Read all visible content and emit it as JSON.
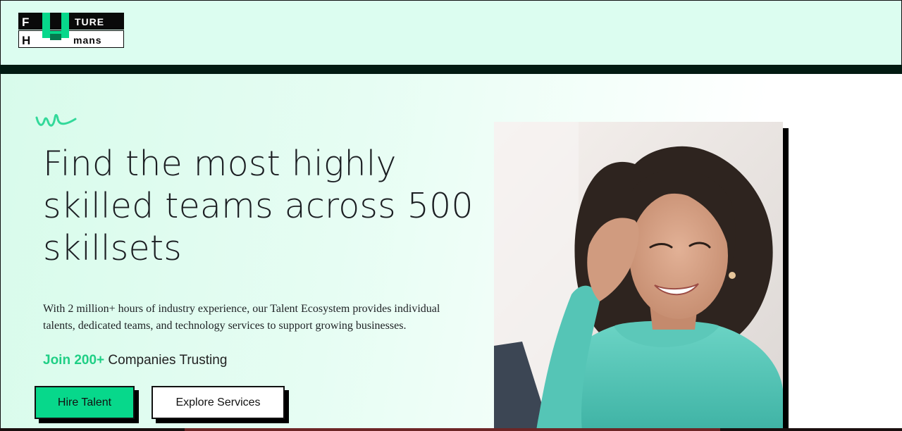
{
  "brand": {
    "logo_top_left": "F",
    "logo_top_right": "TURE",
    "logo_bottom_left": "H",
    "logo_bottom_right": "mans",
    "logo_center": "U"
  },
  "hero": {
    "headline": "Find the most highly skilled teams across 500 skillsets",
    "description": "With 2 million+ hours of industry experience, our Talent Ecosystem provides individual talents, dedicated teams, and technology services to support growing businesses.",
    "trust_accent": "Join 200+",
    "trust_rest": " Companies Trusting",
    "hire_label": "Hire Talent",
    "explore_label": "Explore Services"
  },
  "colors": {
    "header_bg": "#dcfdf0",
    "accent": "#07d88b",
    "accent_text": "#1fcf85",
    "dark": "#021a12"
  },
  "icons": {
    "squiggle": "squiggle-decoration",
    "photo": "woman-at-laptop-photo"
  }
}
